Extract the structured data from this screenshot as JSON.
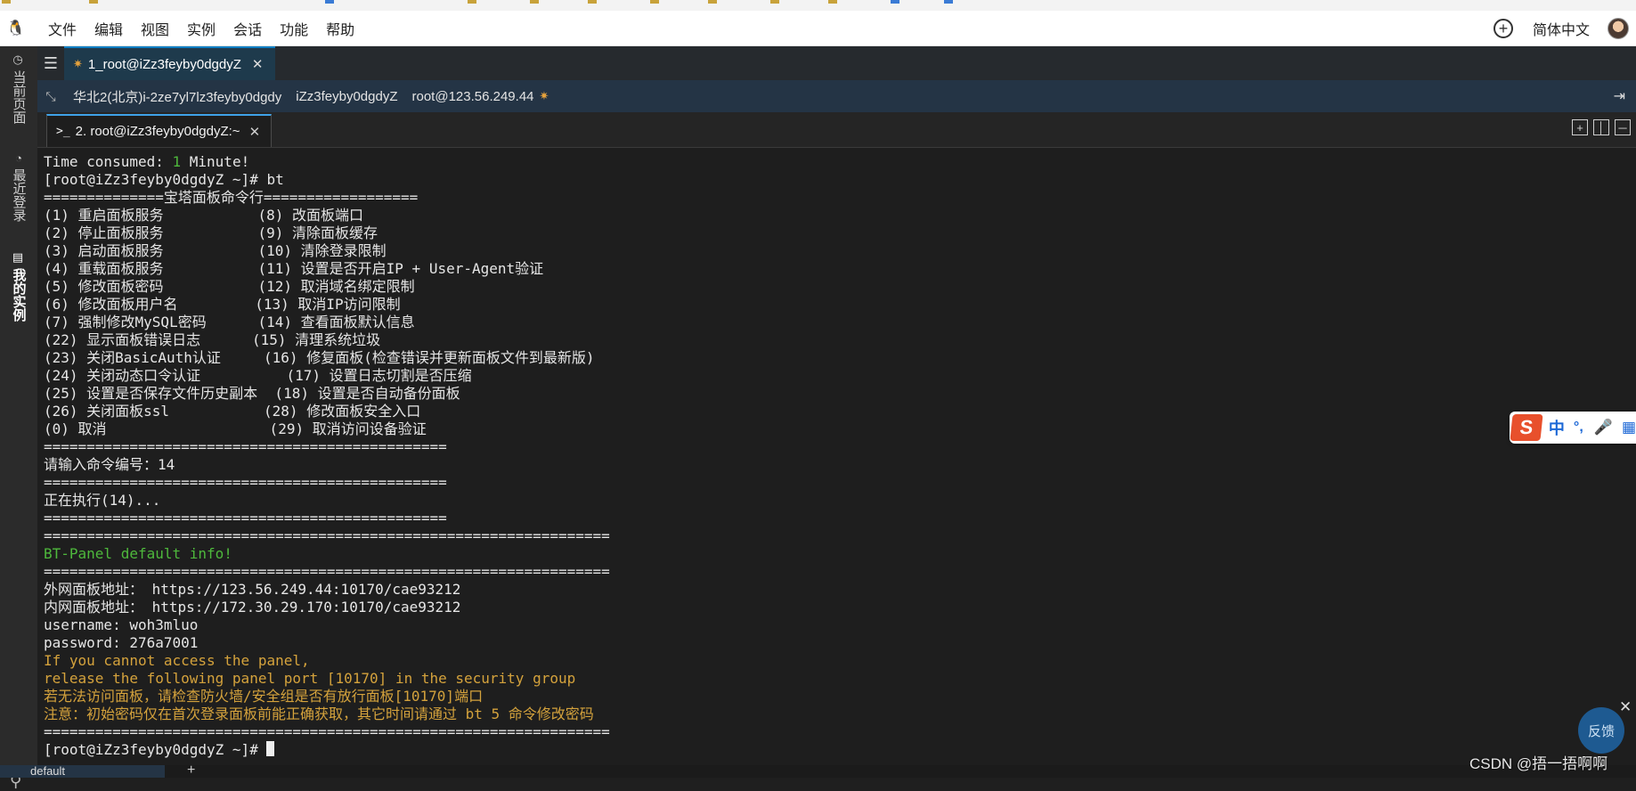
{
  "menubar": {
    "items": [
      "文件",
      "编辑",
      "视图",
      "实例",
      "会话",
      "功能",
      "帮助"
    ],
    "language": "简体中文"
  },
  "vertical_tabs": [
    "当前页面",
    "最近登录",
    "我的实例"
  ],
  "session_tab": {
    "label": "1_root@iZz3feyby0dgdyZ"
  },
  "info_bar": {
    "region_instance": "华北2(北京)i-2ze7yl7lz3feyby0dgdy",
    "hostname": "iZz3feyby0dgdyZ",
    "login": "root@123.56.249.44"
  },
  "terminal_tab": {
    "label": "2. root@iZz3feyby0dgdyZ:~"
  },
  "terminal_lines": [
    {
      "text": "Time consumed: ",
      "accent": "1",
      "rest": " Minute!",
      "color": "default"
    },
    {
      "text": "[root@iZz3feyby0dgdyZ ~]# bt",
      "color": "default"
    },
    {
      "text": "==============宝塔面板命令行==================",
      "color": "default"
    },
    {
      "text": "(1) 重启面板服务           (8) 改面板端口",
      "color": "default"
    },
    {
      "text": "(2) 停止面板服务           (9) 清除面板缓存",
      "color": "default"
    },
    {
      "text": "(3) 启动面板服务           (10) 清除登录限制",
      "color": "default"
    },
    {
      "text": "(4) 重载面板服务           (11) 设置是否开启IP + User-Agent验证",
      "color": "default"
    },
    {
      "text": "(5) 修改面板密码           (12) 取消域名绑定限制",
      "color": "default"
    },
    {
      "text": "(6) 修改面板用户名         (13) 取消IP访问限制",
      "color": "default"
    },
    {
      "text": "(7) 强制修改MySQL密码      (14) 查看面板默认信息",
      "color": "default"
    },
    {
      "text": "(22) 显示面板错误日志      (15) 清理系统垃圾",
      "color": "default"
    },
    {
      "text": "(23) 关闭BasicAuth认证     (16) 修复面板(检查错误并更新面板文件到最新版)",
      "color": "default"
    },
    {
      "text": "(24) 关闭动态口令认证          (17) 设置日志切割是否压缩",
      "color": "default"
    },
    {
      "text": "(25) 设置是否保存文件历史副本  (18) 设置是否自动备份面板",
      "color": "default"
    },
    {
      "text": "(26) 关闭面板ssl           (28) 修改面板安全入口",
      "color": "default"
    },
    {
      "text": "(0) 取消                   (29) 取消访问设备验证",
      "color": "default"
    },
    {
      "text": "===============================================",
      "color": "default"
    },
    {
      "text": "请输入命令编号：14",
      "color": "default"
    },
    {
      "text": "===============================================",
      "color": "default"
    },
    {
      "text": "正在执行(14)...",
      "color": "default"
    },
    {
      "text": "===============================================",
      "color": "default"
    },
    {
      "text": "==================================================================",
      "color": "default"
    },
    {
      "text": "BT-Panel default info!",
      "color": "green"
    },
    {
      "text": "==================================================================",
      "color": "default"
    },
    {
      "text": "外网面板地址： https://123.56.249.44:10170/cae93212",
      "color": "default"
    },
    {
      "text": "内网面板地址： https://172.30.29.170:10170/cae93212",
      "color": "default"
    },
    {
      "text": "username: woh3mluo",
      "color": "default"
    },
    {
      "text": "password: 276a7001",
      "color": "default"
    },
    {
      "text": "If you cannot access the panel,",
      "color": "yellow"
    },
    {
      "text": "release the following panel port [10170] in the security group",
      "color": "yellow"
    },
    {
      "text": "若无法访问面板，请检查防火墙/安全组是否有放行面板[10170]端口",
      "color": "yellow"
    },
    {
      "text": "注意：初始密码仅在首次登录面板前能正确获取，其它时间请通过 bt 5 命令修改密码",
      "color": "yellow"
    },
    {
      "text": "==================================================================",
      "color": "default"
    },
    {
      "text": "[root@iZz3feyby0dgdyZ ~]# ",
      "color": "default",
      "cursor": true
    }
  ],
  "status_tab": {
    "label": "default"
  },
  "ime": {
    "logo": "S",
    "mode": "中",
    "punct": "°,"
  },
  "feedback": {
    "label": "反馈"
  },
  "watermark": "CSDN @捂一捂啊啊",
  "colors": {
    "accent_blue": "#0e7fc4",
    "terminal_green": "#4eb83c",
    "terminal_yellow": "#d4a23c",
    "info_bar_bg": "#243445"
  },
  "icons": [
    "tux-icon",
    "add-circle-icon",
    "avatar",
    "list-icon",
    "expand-icon",
    "exit-icon",
    "terminal-prompt-icon",
    "close-icon",
    "split-icons",
    "pin-icon",
    "mic-icon",
    "grid-icon"
  ]
}
